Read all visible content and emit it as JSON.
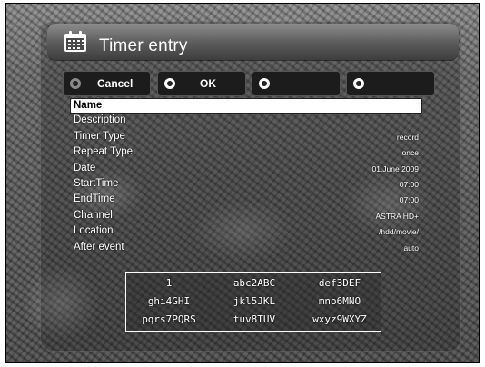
{
  "window": {
    "title": "Timer entry",
    "icon": "calendar-icon"
  },
  "buttons": [
    {
      "label": "Cancel",
      "ring": "red"
    },
    {
      "label": "OK",
      "ring": "green"
    },
    {
      "label": "",
      "ring": "yellow"
    },
    {
      "label": "",
      "ring": "blue"
    }
  ],
  "fields": [
    {
      "name": "Name",
      "value": ""
    },
    {
      "name": "Description",
      "value": ""
    },
    {
      "name": "Timer Type",
      "value": "record"
    },
    {
      "name": "Repeat Type",
      "value": "once"
    },
    {
      "name": "Date",
      "value": "01.June 2009"
    },
    {
      "name": "StartTime",
      "value": "07:00"
    },
    {
      "name": "EndTime",
      "value": "07:00"
    },
    {
      "name": "Channel",
      "value": "ASTRA HD+"
    },
    {
      "name": "Location",
      "value": "/hdd/movie/"
    },
    {
      "name": "After event",
      "value": "auto"
    }
  ],
  "keypad": [
    [
      "1",
      "abc2ABC",
      "def3DEF"
    ],
    [
      "ghi4GHI",
      "jkl5JKL",
      "mno6MNO"
    ],
    [
      "pqrs7PQRS",
      "tuv8TUV",
      "wxyz9WXYZ"
    ]
  ]
}
